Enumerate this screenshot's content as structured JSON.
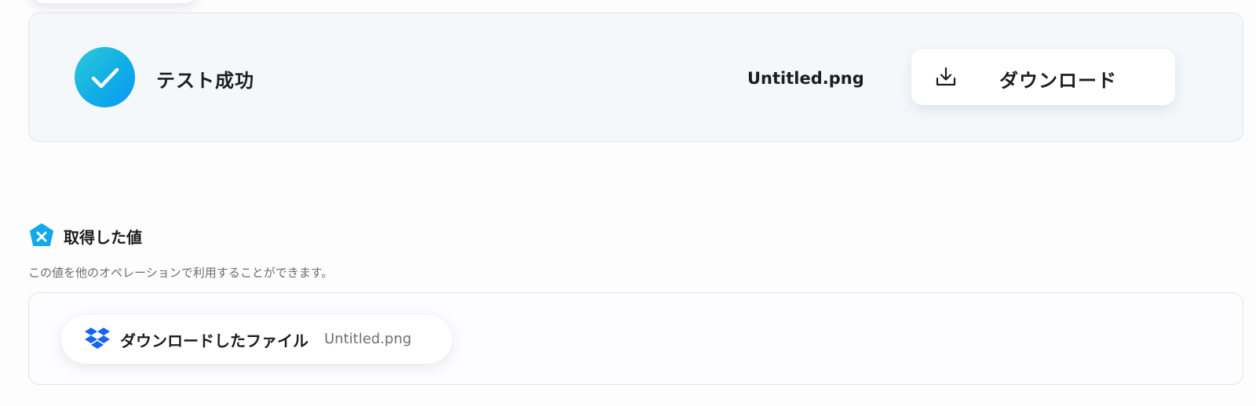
{
  "test_result": {
    "status_text": "テスト成功",
    "file_name": "Untitled.png",
    "download_button_label": "ダウンロード",
    "status_icon": "check-icon",
    "download_icon": "download-icon"
  },
  "retrieved_values": {
    "title": "取得した値",
    "title_icon": "yoom-x-icon",
    "description": "この値を他のオペレーションで利用することができます。",
    "items": [
      {
        "label": "ダウンロードしたファイル",
        "value": "Untitled.png",
        "icon": "dropbox-icon"
      }
    ]
  },
  "colors": {
    "accent_gradient_start": "#2fc9d8",
    "accent_gradient_end": "#1197f0",
    "dropbox_blue": "#1463f2",
    "card_background": "#f5f8fb"
  }
}
